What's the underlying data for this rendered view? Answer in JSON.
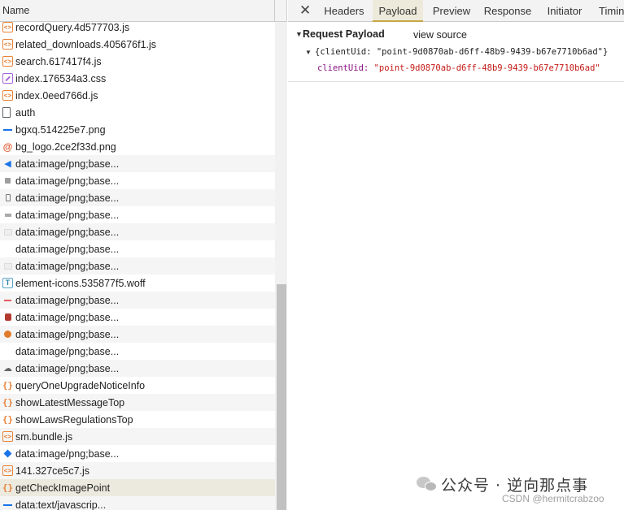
{
  "left_panel": {
    "column_header": "Name",
    "rows": [
      {
        "label": "recordQuery.4d577703.js",
        "icon": "js-file-icon"
      },
      {
        "label": "related_downloads.405676f1.js",
        "icon": "js-file-icon"
      },
      {
        "label": "search.617417f4.js",
        "icon": "js-file-icon"
      },
      {
        "label": "index.176534a3.css",
        "icon": "css-file-icon"
      },
      {
        "label": "index.0eed766d.js",
        "icon": "js-file-icon"
      },
      {
        "label": "auth",
        "icon": "document-icon"
      },
      {
        "label": "bgxq.514225e7.png",
        "icon": "image-line-icon"
      },
      {
        "label": "bg_logo.2ce2f33d.png",
        "icon": "logo-image-icon"
      },
      {
        "label": "data:image/png;base...",
        "icon": "speaker-image-icon"
      },
      {
        "label": "data:image/png;base...",
        "icon": "small-image-icon"
      },
      {
        "label": "data:image/png;base...",
        "icon": "phone-image-icon"
      },
      {
        "label": "data:image/png;base...",
        "icon": "bar-image-icon"
      },
      {
        "label": "data:image/png;base...",
        "icon": "faint-image-icon"
      },
      {
        "label": "data:image/png;base...",
        "icon": "blank-image-icon"
      },
      {
        "label": "data:image/png;base...",
        "icon": "faint-image-icon"
      },
      {
        "label": "element-icons.535877f5.woff",
        "icon": "font-file-icon"
      },
      {
        "label": "data:image/png;base...",
        "icon": "red-line-image-icon"
      },
      {
        "label": "data:image/png;base...",
        "icon": "red-image-icon"
      },
      {
        "label": "data:image/png;base...",
        "icon": "orange-image-icon"
      },
      {
        "label": "data:image/png;base...",
        "icon": "blank-image-icon"
      },
      {
        "label": "data:image/png;base...",
        "icon": "cloud-image-icon"
      },
      {
        "label": "queryOneUpgradeNoticeInfo",
        "icon": "fetch-icon"
      },
      {
        "label": "showLatestMessageTop",
        "icon": "fetch-icon"
      },
      {
        "label": "showLawsRegulationsTop",
        "icon": "fetch-icon"
      },
      {
        "label": "sm.bundle.js",
        "icon": "js-file-icon"
      },
      {
        "label": "data:image/png;base...",
        "icon": "diamond-image-icon"
      },
      {
        "label": "141.327ce5c7.js",
        "icon": "js-file-icon"
      },
      {
        "label": "getCheckImagePoint",
        "icon": "fetch-icon",
        "selected": true
      },
      {
        "label": "data:text/javascrip...",
        "icon": "image-line-icon"
      }
    ]
  },
  "tabs": {
    "close_glyph": "✕",
    "items": [
      "Headers",
      "Payload",
      "Preview",
      "Response",
      "Initiator",
      "Timin"
    ],
    "active": "Payload"
  },
  "payload": {
    "section_title": "Request Payload",
    "view_source": "view source",
    "object_summary": "{clientUid: \"point-9d0870ab-d6ff-48b9-9439-b67e7710b6ad\"}",
    "property_key": "clientUid",
    "property_value": "\"point-9d0870ab-d6ff-48b9-9439-b67e7710b6ad\""
  },
  "watermark": {
    "text": "公众号 · 逆向那点事",
    "csdn": "CSDN @hermitcrabzoo"
  }
}
